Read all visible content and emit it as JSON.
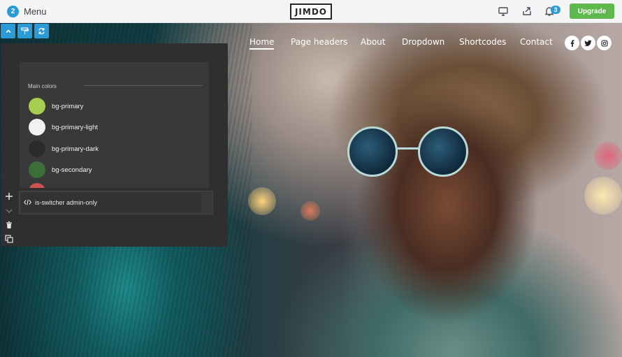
{
  "admin_bar": {
    "menu_count": "2",
    "menu_label": "Menu",
    "logo_text": "JIMDO",
    "notification_count": "3",
    "upgrade_label": "Upgrade"
  },
  "site_nav": {
    "items": [
      {
        "label": "Home",
        "active": true
      },
      {
        "label": "Page headers",
        "active": false
      },
      {
        "label": "About",
        "active": false
      },
      {
        "label": "Dropdown",
        "active": false
      },
      {
        "label": "Shortcodes",
        "active": false
      },
      {
        "label": "Contact",
        "active": false
      }
    ],
    "social": [
      "facebook-icon",
      "twitter-icon",
      "instagram-icon"
    ]
  },
  "editor_toolbar": {
    "buttons": [
      "chevron-up-icon",
      "paint-roller-icon",
      "refresh-icon"
    ]
  },
  "color_panel": {
    "section_title": "Main colors",
    "swatches": [
      {
        "label": "bg-primary",
        "color": "#a4cf4f"
      },
      {
        "label": "bg-primary-light",
        "color": "#f1f1f1"
      },
      {
        "label": "bg-primary-dark",
        "color": "#2b2b2b"
      },
      {
        "label": "bg-secondary",
        "color": "#3c6e3a"
      },
      {
        "label": "",
        "color": "#d0524f"
      }
    ]
  },
  "element_bar": {
    "code_label": "is-switcher admin-only"
  },
  "side_actions": [
    "plus-icon",
    "chevron-down-icon",
    "trash-icon",
    "duplicate-icon"
  ],
  "colors": {
    "accent": "#2a9bd6",
    "upgrade": "#5eb84d",
    "panel": "#2f2f2f"
  }
}
